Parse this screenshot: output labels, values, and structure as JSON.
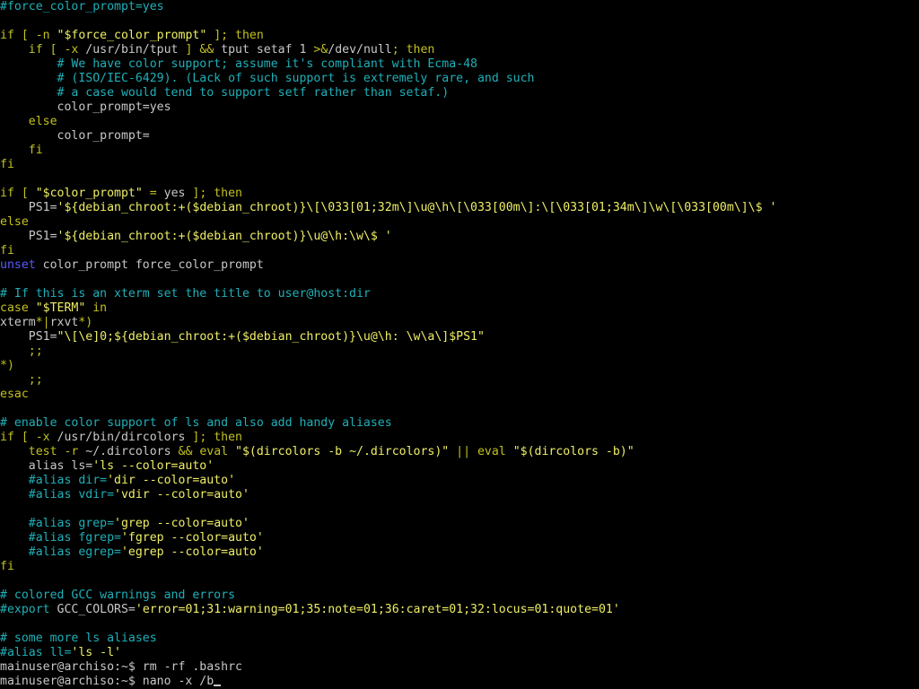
{
  "colors": {
    "background": "#000000",
    "default": "#c8c8c8",
    "comment": "#1fb0b8",
    "keyword": "#c2c021",
    "string": "#eeee66",
    "variable": "#e9e9a0",
    "operator": "#c8c8c8",
    "blue": "#5a5aff",
    "cursor": "#c8c8c8"
  },
  "terminal": {
    "prompt_user_host": "mainuser@archiso",
    "lines": [
      {
        "segments": [
          {
            "c": "comment",
            "t": "#force_color_prompt=yes"
          }
        ]
      },
      {
        "segments": []
      },
      {
        "segments": [
          {
            "c": "keyword",
            "t": "if [ -n "
          },
          {
            "c": "string",
            "t": "\"$force_color_prompt\""
          },
          {
            "c": "keyword",
            "t": " ]; then"
          }
        ]
      },
      {
        "segments": [
          {
            "c": "keyword",
            "t": "    if [ -x "
          },
          {
            "c": "default",
            "t": "/usr/bin/tput"
          },
          {
            "c": "keyword",
            "t": " ] && "
          },
          {
            "c": "default",
            "t": "tput setaf 1 "
          },
          {
            "c": "keyword",
            "t": ">&"
          },
          {
            "c": "default",
            "t": "/dev/null"
          },
          {
            "c": "keyword",
            "t": "; then"
          }
        ]
      },
      {
        "segments": [
          {
            "c": "comment",
            "t": "        # We have color support; assume it's compliant with Ecma-48"
          }
        ]
      },
      {
        "segments": [
          {
            "c": "comment",
            "t": "        # (ISO/IEC-6429). (Lack of such support is extremely rare, and such"
          }
        ]
      },
      {
        "segments": [
          {
            "c": "comment",
            "t": "        # a case would tend to support setf rather than setaf.)"
          }
        ]
      },
      {
        "segments": [
          {
            "c": "default",
            "t": "        color_prompt=yes"
          }
        ]
      },
      {
        "segments": [
          {
            "c": "keyword",
            "t": "    else"
          }
        ]
      },
      {
        "segments": [
          {
            "c": "default",
            "t": "        color_prompt="
          }
        ]
      },
      {
        "segments": [
          {
            "c": "keyword",
            "t": "    fi"
          }
        ]
      },
      {
        "segments": [
          {
            "c": "keyword",
            "t": "fi"
          }
        ]
      },
      {
        "segments": []
      },
      {
        "segments": [
          {
            "c": "keyword",
            "t": "if [ "
          },
          {
            "c": "string",
            "t": "\"$color_prompt\""
          },
          {
            "c": "keyword",
            "t": " = "
          },
          {
            "c": "default",
            "t": "yes"
          },
          {
            "c": "keyword",
            "t": " ]; then"
          }
        ]
      },
      {
        "segments": [
          {
            "c": "default",
            "t": "    PS1="
          },
          {
            "c": "string",
            "t": "'${debian_chroot:+($debian_chroot)}\\[\\033[01;32m\\]\\u@\\h\\[\\033[00m\\]:\\[\\033[01;34m\\]\\w\\[\\033[00m\\]\\$ '"
          }
        ]
      },
      {
        "segments": [
          {
            "c": "keyword",
            "t": "else"
          }
        ]
      },
      {
        "segments": [
          {
            "c": "default",
            "t": "    PS1="
          },
          {
            "c": "string",
            "t": "'${debian_chroot:+($debian_chroot)}\\u@\\h:\\w\\$ '"
          }
        ]
      },
      {
        "segments": [
          {
            "c": "keyword",
            "t": "fi"
          }
        ]
      },
      {
        "segments": [
          {
            "c": "blue",
            "t": "unset"
          },
          {
            "c": "default",
            "t": " color_prompt force_color_prompt"
          }
        ]
      },
      {
        "segments": []
      },
      {
        "segments": [
          {
            "c": "comment",
            "t": "# If this is an xterm set the title to user@host:dir"
          }
        ]
      },
      {
        "segments": [
          {
            "c": "keyword",
            "t": "case "
          },
          {
            "c": "string",
            "t": "\"$TERM\""
          },
          {
            "c": "keyword",
            "t": " in"
          }
        ]
      },
      {
        "segments": [
          {
            "c": "default",
            "t": "xterm"
          },
          {
            "c": "keyword",
            "t": "*|"
          },
          {
            "c": "default",
            "t": "rxvt"
          },
          {
            "c": "keyword",
            "t": "*)"
          }
        ]
      },
      {
        "segments": [
          {
            "c": "default",
            "t": "    PS1="
          },
          {
            "c": "string",
            "t": "\"\\[\\e]0;${debian_chroot:+($debian_chroot)}\\u@\\h: \\w\\a\\]$PS1\""
          }
        ]
      },
      {
        "segments": [
          {
            "c": "keyword",
            "t": "    ;;"
          }
        ]
      },
      {
        "segments": [
          {
            "c": "keyword",
            "t": "*)"
          }
        ]
      },
      {
        "segments": [
          {
            "c": "keyword",
            "t": "    ;;"
          }
        ]
      },
      {
        "segments": [
          {
            "c": "keyword",
            "t": "esac"
          }
        ]
      },
      {
        "segments": []
      },
      {
        "segments": [
          {
            "c": "comment",
            "t": "# enable color support of ls and also add handy aliases"
          }
        ]
      },
      {
        "segments": [
          {
            "c": "keyword",
            "t": "if [ -x "
          },
          {
            "c": "default",
            "t": "/usr/bin/dircolors"
          },
          {
            "c": "keyword",
            "t": " ]; then"
          }
        ]
      },
      {
        "segments": [
          {
            "c": "keyword",
            "t": "    test -r "
          },
          {
            "c": "default",
            "t": "~/.dircolors "
          },
          {
            "c": "keyword",
            "t": "&& eval "
          },
          {
            "c": "string",
            "t": "\"$(dircolors -b ~/.dircolors)\""
          },
          {
            "c": "keyword",
            "t": " || eval "
          },
          {
            "c": "string",
            "t": "\"$(dircolors -b)\""
          }
        ]
      },
      {
        "segments": [
          {
            "c": "default",
            "t": "    alias ls="
          },
          {
            "c": "string",
            "t": "'ls --color=auto'"
          }
        ]
      },
      {
        "segments": [
          {
            "c": "comment",
            "t": "    #alias dir="
          },
          {
            "c": "string",
            "t": "'dir --color=auto'"
          }
        ]
      },
      {
        "segments": [
          {
            "c": "comment",
            "t": "    #alias vdir="
          },
          {
            "c": "string",
            "t": "'vdir --color=auto'"
          }
        ]
      },
      {
        "segments": []
      },
      {
        "segments": [
          {
            "c": "comment",
            "t": "    #alias grep="
          },
          {
            "c": "string",
            "t": "'grep --color=auto'"
          }
        ]
      },
      {
        "segments": [
          {
            "c": "comment",
            "t": "    #alias fgrep="
          },
          {
            "c": "string",
            "t": "'fgrep --color=auto'"
          }
        ]
      },
      {
        "segments": [
          {
            "c": "comment",
            "t": "    #alias egrep="
          },
          {
            "c": "string",
            "t": "'egrep --color=auto'"
          }
        ]
      },
      {
        "segments": [
          {
            "c": "keyword",
            "t": "fi"
          }
        ]
      },
      {
        "segments": []
      },
      {
        "segments": [
          {
            "c": "comment",
            "t": "# colored GCC warnings and errors"
          }
        ]
      },
      {
        "segments": [
          {
            "c": "comment",
            "t": "#export "
          },
          {
            "c": "default",
            "t": "GCC_COLORS="
          },
          {
            "c": "string",
            "t": "'error=01;31:warning=01;35:note=01;36:caret=01;32:locus=01:quote=01'"
          }
        ]
      },
      {
        "segments": []
      },
      {
        "segments": [
          {
            "c": "comment",
            "t": "# some more ls aliases"
          }
        ]
      },
      {
        "segments": [
          {
            "c": "comment",
            "t": "#alias ll="
          },
          {
            "c": "string",
            "t": "'ls -l'"
          }
        ]
      },
      {
        "segments": [
          {
            "c": "default",
            "t": "mainuser@archiso:~$ rm -rf .bashrc"
          }
        ]
      },
      {
        "segments": [
          {
            "c": "default",
            "t": "mainuser@archiso:~$ nano -x /b"
          }
        ],
        "cursor": true
      }
    ]
  }
}
